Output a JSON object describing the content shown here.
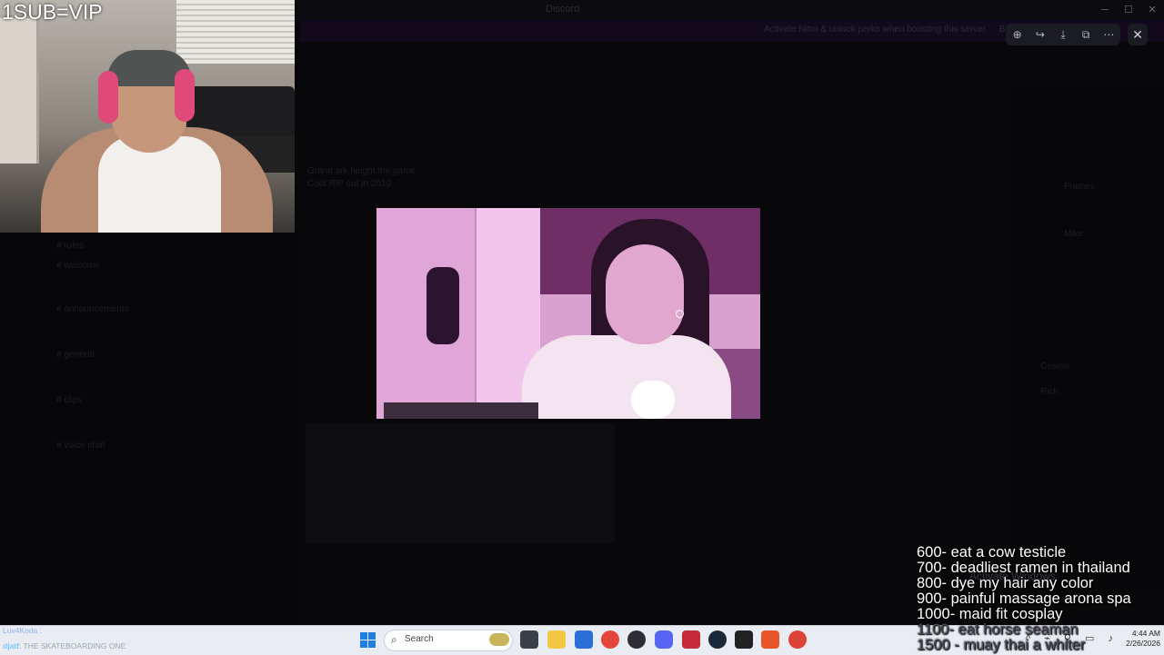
{
  "background_app": {
    "window_title": "Discord",
    "banner": "Activate Nitro & unlock perks when boosting this server",
    "banner_action": "Boost",
    "channels": [
      "# rules",
      "# welcome",
      "# announcements",
      "# general",
      "# clips",
      "# voice chat"
    ],
    "messages": [
      "Grand ark height the game",
      "Cool RIP out in 2010"
    ],
    "members": [
      "Frames",
      "Mike",
      "Cosmo",
      "Rich"
    ]
  },
  "viewer_toolbar": {
    "tools": [
      "zoom-in-icon",
      "share-icon",
      "download-icon",
      "open-external-icon",
      "more-icon"
    ],
    "close_glyph": "✕"
  },
  "webcam": {
    "overlay_text": "1SUB=VIP"
  },
  "goals": [
    "600- eat a cow testicle",
    "700- deadliest ramen in thailand",
    "800- dye my hair any color",
    "900- painful massage arona spa",
    "1000- maid fit cosplay",
    "1100- eat horse seaman",
    "1500 - muay thai a whiter"
  ],
  "watermark": "Activate Windows",
  "chat_ticker": {
    "line1": "Luv4Koda :",
    "line2_user": "djatf",
    "line2_text": ": THE SKATEBOARDING ONE"
  },
  "taskbar": {
    "search_placeholder": "Search",
    "time": "4:44 AM",
    "date": "2/26/2026",
    "tray_glyphs": "^ ⌁ ⚲ ▭ ♪"
  }
}
